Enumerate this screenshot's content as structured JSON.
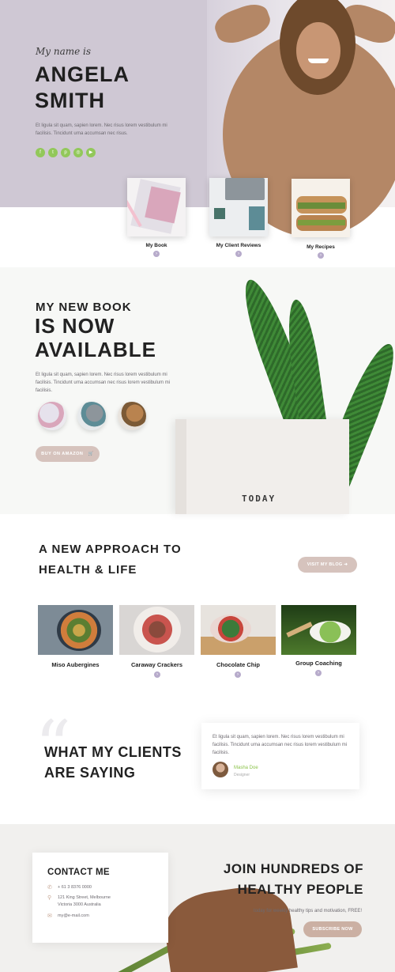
{
  "hero": {
    "script_intro": "My name is",
    "name_line1": "ANGELA",
    "name_line2": "SMITH",
    "intro_text": "Et ligula sit quam, sapien lorem. Nec risus lorem vestibulum mi facilisis. Tincidunt urna accumsan nec risus.",
    "socials": [
      {
        "icon": "facebook-icon",
        "glyph": "f"
      },
      {
        "icon": "twitter-icon",
        "glyph": "t"
      },
      {
        "icon": "pinterest-icon",
        "glyph": "p"
      },
      {
        "icon": "instagram-icon",
        "glyph": "◎"
      },
      {
        "icon": "youtube-icon",
        "glyph": "▶"
      }
    ]
  },
  "cards": [
    {
      "label": "My Book"
    },
    {
      "label": "My Client Reviews"
    },
    {
      "label": "My Recipes"
    }
  ],
  "book": {
    "subtitle": "MY NEW BOOK",
    "title_line1": "IS NOW",
    "title_line2": "AVAILABLE",
    "text": "Et ligula sit quam, sapien lorem. Nec risus lorem vestibulum mi facilisis. Tincidunt urna accumsan nec risus lorem vestibulum mi facilisis.",
    "button_label": "BUY ON AMAZON",
    "cover_text": "TODAY"
  },
  "health": {
    "title_line1": "A NEW APPROACH TO",
    "title_line2": "HEALTH & LIFE",
    "blog_button": "VISIT MY BLOG",
    "recipes": [
      {
        "label": "Miso Aubergines"
      },
      {
        "label": "Caraway Crackers"
      },
      {
        "label": "Chocolate Chip"
      },
      {
        "label": "Group Coaching"
      }
    ]
  },
  "testimonial": {
    "title_line1": "WHAT MY CLIENTS",
    "title_line2": "ARE SAYING",
    "quote": "Et ligula sit quam, sapien lorem. Nec risus lorem vestibulum mi facilisis. Tincidunt urna accumsan nec risus lorem vestibulum mi facilisis.",
    "author_name": "Masha Doe",
    "author_role": "Designer"
  },
  "contact": {
    "title": "CONTACT ME",
    "phone": "+ 61 3 8376 0000",
    "address_line1": "121 King Street, Melbourne",
    "address_line2": "Victoria 3000 Australia",
    "email": "my@e-mail.com"
  },
  "join": {
    "title_line1": "JOIN HUNDREDS OF",
    "title_line2": "HEALTHY PEOPLE",
    "text": "today for weekly healthy tips and motivation, FREE!",
    "button_label": "SUBSCRIBE NOW"
  },
  "colors": {
    "accent_green": "#92c85a",
    "button_pink": "#d6c3bd",
    "hero_bg": "#cfc8d4",
    "arrow_purple": "#b7abcb"
  }
}
